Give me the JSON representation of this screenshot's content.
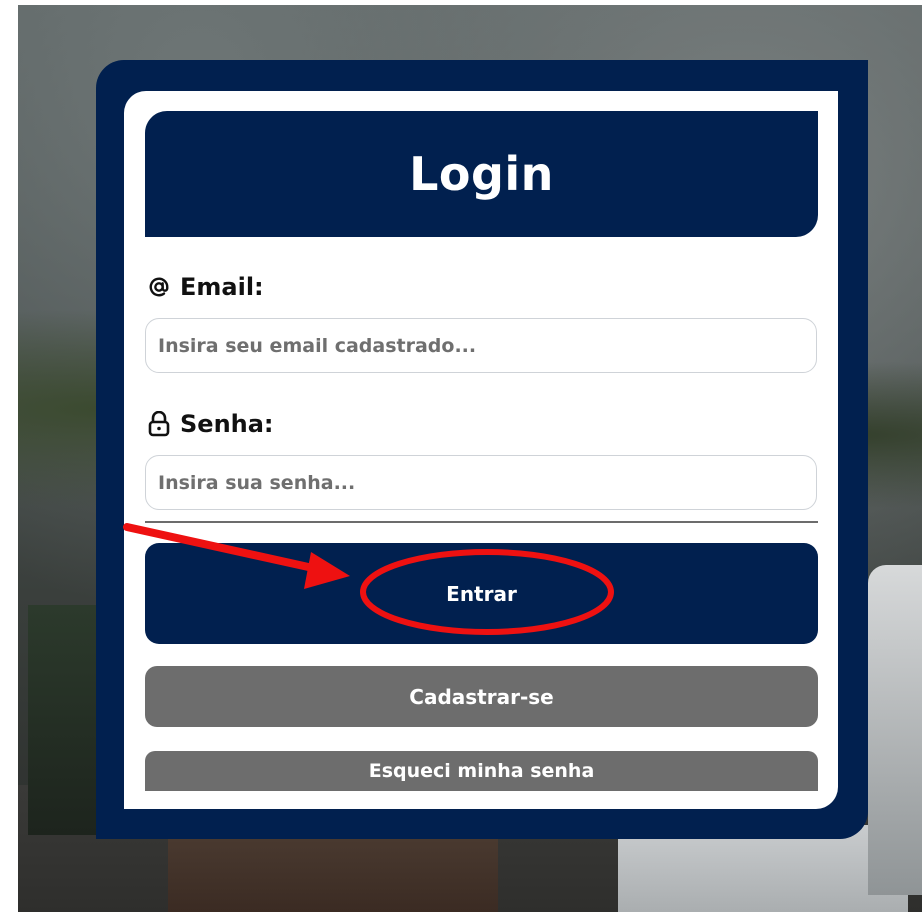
{
  "login_form": {
    "title": "Login",
    "email": {
      "label": "Email:",
      "icon": "at-sign-icon",
      "placeholder": "Insira seu email cadastrado...",
      "value": ""
    },
    "password": {
      "label": "Senha:",
      "icon": "lock-icon",
      "placeholder": "Insira sua senha...",
      "value": ""
    },
    "buttons": {
      "login": "Entrar",
      "register": "Cadastrar-se",
      "forgot_password": "Esqueci minha senha"
    }
  },
  "colors": {
    "brand_navy": "#01204f",
    "secondary_gray": "#6d6d6d",
    "annotation_red": "#ee1111"
  },
  "annotation": {
    "type": "red arrow and ellipse highlighting the login button"
  }
}
